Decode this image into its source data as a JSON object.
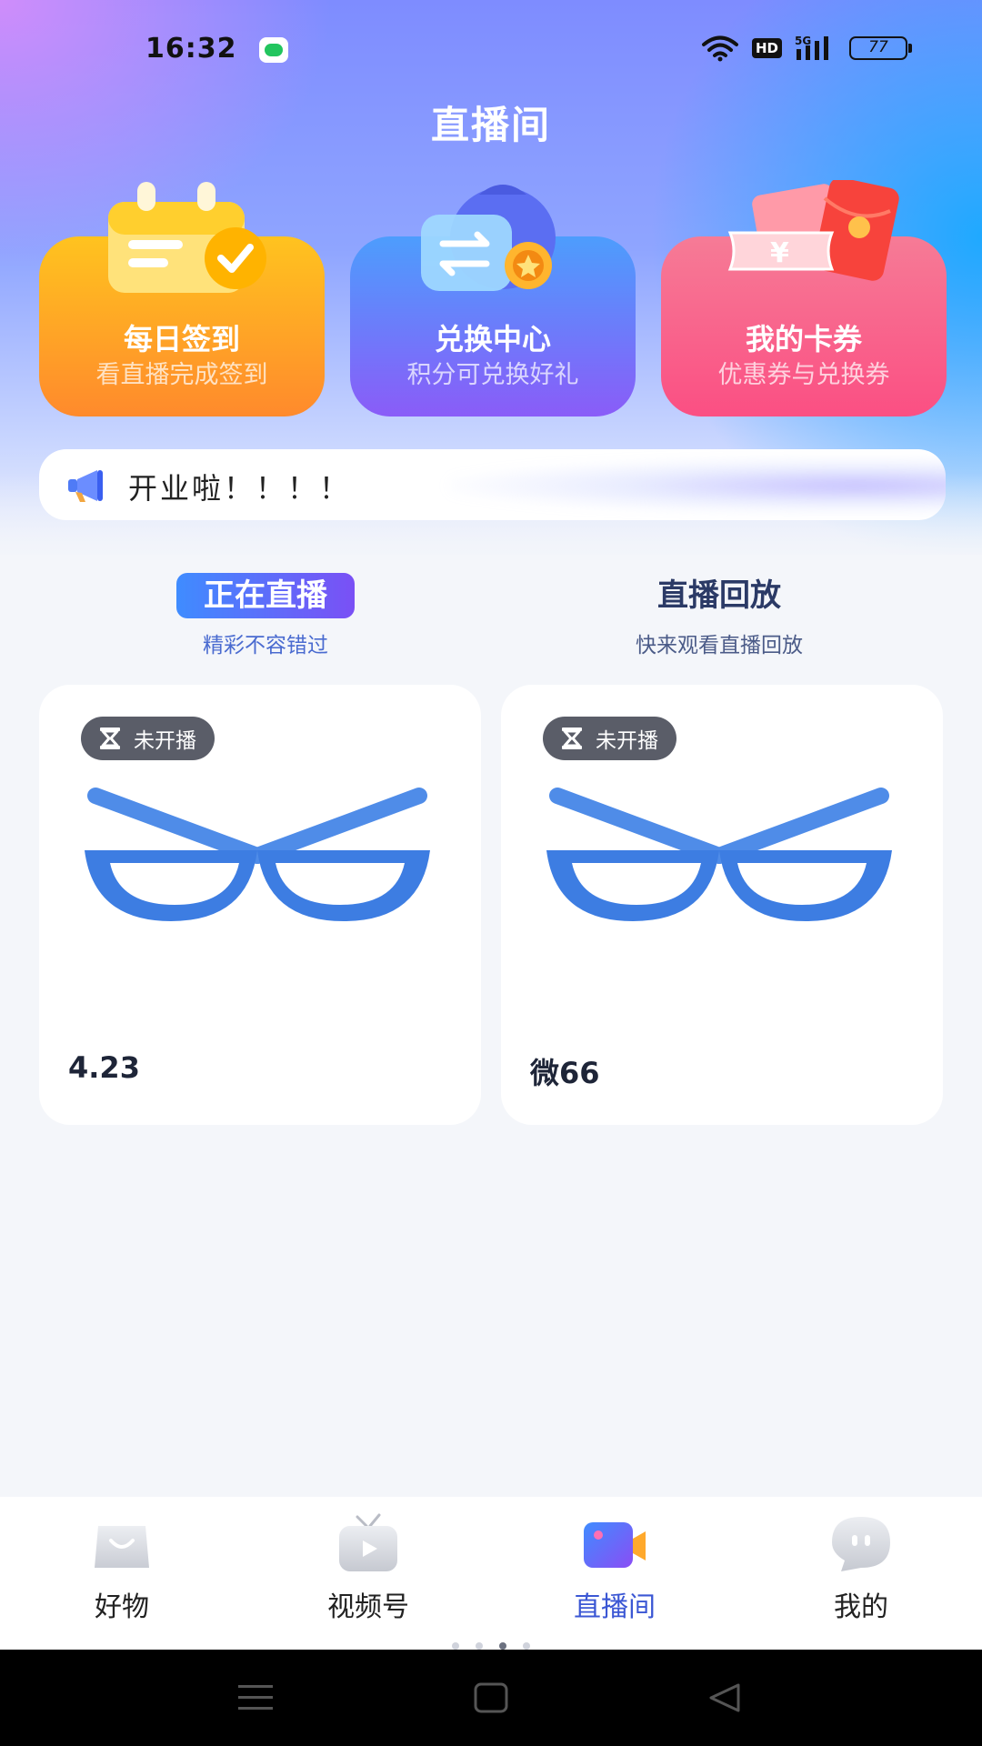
{
  "status_bar": {
    "time": "16:32",
    "network_badge": "HD",
    "signal_label": "5G",
    "battery": "77",
    "icons": [
      "message-icon",
      "wifi-icon",
      "hd-icon",
      "signal-icon",
      "battery-icon"
    ]
  },
  "header": {
    "title": "直播间"
  },
  "features": [
    {
      "title": "每日签到",
      "subtitle": "看直播完成签到",
      "icon": "calendar-check-icon"
    },
    {
      "title": "兑换中心",
      "subtitle": "积分可兑换好礼",
      "icon": "exchange-bag-icon"
    },
    {
      "title": "我的卡券",
      "subtitle": "优惠券与兑换券",
      "icon": "coupon-ticket-icon"
    }
  ],
  "announcement": {
    "text": "开业啦！！！！",
    "icon": "megaphone-icon"
  },
  "tabs": [
    {
      "label": "正在直播",
      "sub": "精彩不容错过",
      "active": true
    },
    {
      "label": "直播回放",
      "sub": "快来观看直播回放",
      "active": false
    }
  ],
  "streams": [
    {
      "status": "未开播",
      "title": "4.23",
      "icon": "hourglass-icon"
    },
    {
      "status": "未开播",
      "title": "微66",
      "icon": "hourglass-icon"
    }
  ],
  "bottom_nav": [
    {
      "label": "好物",
      "icon": "shopping-bag-icon",
      "active": false
    },
    {
      "label": "视频号",
      "icon": "tv-icon",
      "active": false
    },
    {
      "label": "直播间",
      "icon": "video-camera-icon",
      "active": true
    },
    {
      "label": "我的",
      "icon": "profile-face-icon",
      "active": false
    }
  ],
  "colors": {
    "accent": "#3b57d4",
    "checkin_card": "#ffb020",
    "exchange_card": "#6a7cfb",
    "coupon_card": "#fb5f8a",
    "status_pill": "#5a5d68",
    "glasses_blue": "#3b7be6"
  }
}
